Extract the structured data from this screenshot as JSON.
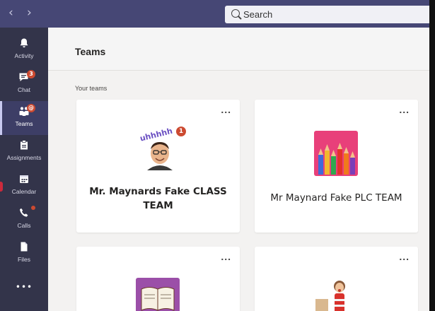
{
  "topbar": {
    "back_icon": "‹",
    "forward_icon": "›",
    "search": {
      "label": "Search",
      "icon": "search-icon"
    }
  },
  "rail": {
    "items": [
      {
        "label": "Activity",
        "icon": "bell-icon"
      },
      {
        "label": "Chat",
        "icon": "chat-icon",
        "badge": "3"
      },
      {
        "label": "Teams",
        "icon": "teams-icon",
        "badge": "@"
      },
      {
        "label": "Assignments",
        "icon": "assignments-icon"
      },
      {
        "label": "Calendar",
        "icon": "calendar-icon"
      },
      {
        "label": "Calls",
        "icon": "phone-icon"
      },
      {
        "label": "Files",
        "icon": "file-icon"
      }
    ],
    "more": "•••"
  },
  "header": {
    "title": "Teams"
  },
  "section": {
    "label": "Your teams"
  },
  "teams": [
    {
      "name": "Mr. Maynards Fake CLASS TEAM",
      "badge": "1",
      "avatar_text": "uhhhhh",
      "more": "..."
    },
    {
      "name": "Mr Maynard Fake PLC TEAM",
      "more": "..."
    },
    {
      "name": "",
      "more": "..."
    },
    {
      "name": "",
      "more": "..."
    }
  ],
  "colors": {
    "topbar": "#464775",
    "rail": "#33344a",
    "accent_badge": "#cc4a31",
    "pencils_bg": "#e8407a",
    "book_bg": "#9b4fa8"
  }
}
